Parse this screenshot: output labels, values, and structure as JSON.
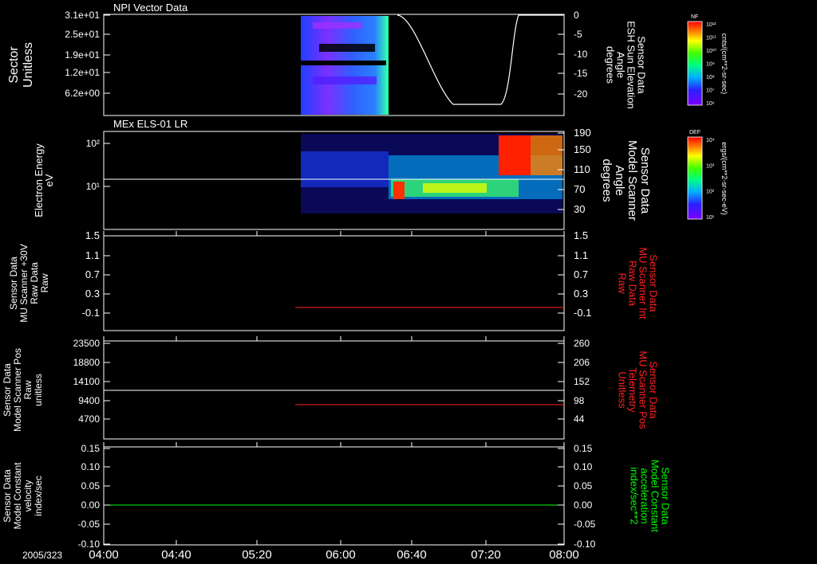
{
  "date_label": "2005/323",
  "time_axis": {
    "labels": [
      "04:00",
      "04:40",
      "05:20",
      "06:00",
      "06:40",
      "07:20",
      "08:00"
    ]
  },
  "panels": [
    {
      "title": "NPI Vector Data",
      "left_label": [
        "Sector",
        "Unitless"
      ],
      "right_label": [
        "Sensor Data",
        "ESH Sun Elevation",
        "Angle",
        "degrees"
      ],
      "left_ticks": [
        "3.1e+01",
        "2.5e+01",
        "1.9e+01",
        "1.2e+01",
        "6.2e+00"
      ],
      "right_ticks": [
        "0",
        "-5",
        "-10",
        "-15",
        "-20"
      ],
      "colorbar": {
        "label": "NF",
        "unit": "cnts/(cm**2-sr-sec)",
        "ticks": [
          "10¹²",
          "10¹¹",
          "10¹⁰",
          "10⁹",
          "10⁸",
          "10⁷",
          "10⁶"
        ]
      }
    },
    {
      "title": "MEx ELS-01 LR",
      "left_label": [
        "Electron Energy",
        "eV"
      ],
      "right_label": [
        "Sensor Data",
        "Model Scanner",
        "Angle",
        "degrees"
      ],
      "left_ticks": [
        "10²",
        "10¹"
      ],
      "right_ticks": [
        "190",
        "150",
        "110",
        "70",
        "30"
      ],
      "colorbar": {
        "label": "DEF",
        "unit": "ergs/(cm**2-sr-sec-eV)",
        "ticks": [
          "10⁴",
          "10³",
          "10²",
          "10¹"
        ]
      }
    },
    {
      "left_label": [
        "Sensor Data",
        "MU Scanner +30V",
        "Raw Data",
        "Raw"
      ],
      "right_label": [
        "Sensor Data",
        "MU Scanner Int",
        "Raw Data",
        "Raw"
      ],
      "left_ticks": [
        "1.5",
        "1.1",
        "0.7",
        "0.3",
        "-0.1"
      ],
      "right_ticks": [
        "1.5",
        "1.1",
        "0.7",
        "0.3",
        "-0.1"
      ]
    },
    {
      "left_label": [
        "Sensor Data",
        "Model Scanner Pos",
        "Raw",
        "unitless"
      ],
      "right_label": [
        "Sensor Data",
        "MU Scanner Pos",
        "Telemetry",
        "Unitless"
      ],
      "left_ticks": [
        "23500",
        "18800",
        "14100",
        "9400",
        "4700"
      ],
      "right_ticks": [
        "260",
        "206",
        "152",
        "98",
        "44"
      ]
    },
    {
      "left_label": [
        "Sensor Data",
        "Model Constant",
        "velocity",
        "index/sec"
      ],
      "right_label": [
        "Sensor Data",
        "Model Constant",
        "acceleration",
        "index/sec**2"
      ],
      "left_ticks": [
        "0.15",
        "0.10",
        "0.05",
        "0.00",
        "-0.05",
        "-0.10"
      ],
      "right_ticks": [
        "0.15",
        "0.10",
        "0.05",
        "0.00",
        "-0.05",
        "-0.10"
      ]
    }
  ],
  "colors": {
    "white": "#ffffff",
    "red": "#ff2020",
    "green": "#00ff00",
    "black": "#000000"
  }
}
